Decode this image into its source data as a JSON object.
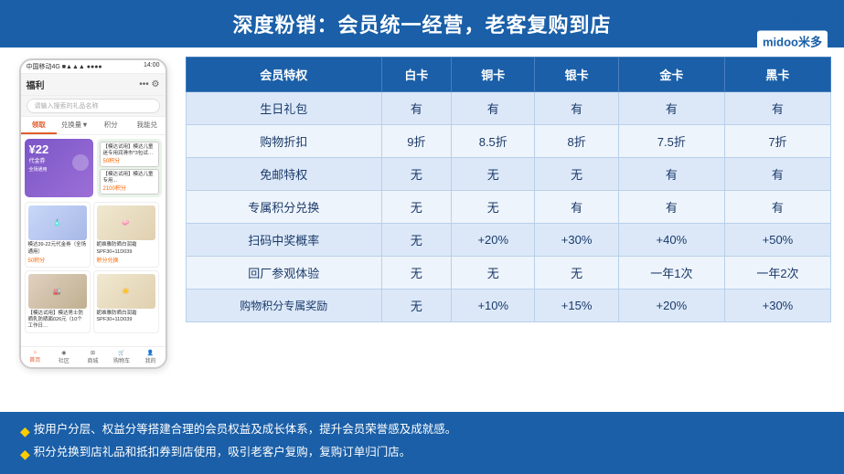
{
  "header": {
    "title": "深度粉销：会员统一经营，老客复购到店"
  },
  "logo": {
    "text": "midoo米多",
    "figure_color": "#1a5fa8"
  },
  "phone": {
    "status_bar": "中国移动4G  ■▲▲▲ ●●●●",
    "time": "14:00",
    "nav_title": "福利",
    "search_placeholder": "请输入搜索的礼品名称",
    "tabs": [
      "领取",
      "兑换量▼",
      "积分",
      "我能兑"
    ],
    "active_tab": 0,
    "coupon_price": "¥22",
    "coupon_label": "代金券",
    "points1": "50积分",
    "points2": "2100积分",
    "product1_name": "模达39-22元代金券（全场通用）",
    "product2_name": "【模达试用】模达儿童迷专用润滑市*3包试…",
    "product3_name": "【模达试用】模达男士防晒乳防晒面026元（10个工作日…",
    "product4_name": "妮维雅防晒白润霜SPF30+11D039",
    "bottom_nav": [
      "首页",
      "社区",
      "商城",
      "购物车",
      "我的"
    ]
  },
  "table": {
    "headers": [
      "会员特权",
      "白卡",
      "铜卡",
      "银卡",
      "金卡",
      "黑卡"
    ],
    "rows": [
      [
        "生日礼包",
        "有",
        "有",
        "有",
        "有",
        "有"
      ],
      [
        "购物折扣",
        "9折",
        "8.5折",
        "8折",
        "7.5折",
        "7折"
      ],
      [
        "免邮特权",
        "无",
        "无",
        "无",
        "有",
        "有"
      ],
      [
        "专属积分兑换",
        "无",
        "无",
        "有",
        "有",
        "有"
      ],
      [
        "扫码中奖概率",
        "无",
        "+20%",
        "+30%",
        "+40%",
        "+50%"
      ],
      [
        "回厂参观体验",
        "无",
        "无",
        "无",
        "一年1次",
        "一年2次"
      ],
      [
        "购物积分专属奖励",
        "无",
        "+10%",
        "+15%",
        "+20%",
        "+30%"
      ]
    ]
  },
  "footer": {
    "items": [
      "按用户分层、权益分等搭建合理的会员权益及成长体系，提升会员荣誉感及成就感。",
      "积分兑换到店礼品和抵扣券到店使用，吸引老客户复购，复购订单归门店。"
    ]
  }
}
